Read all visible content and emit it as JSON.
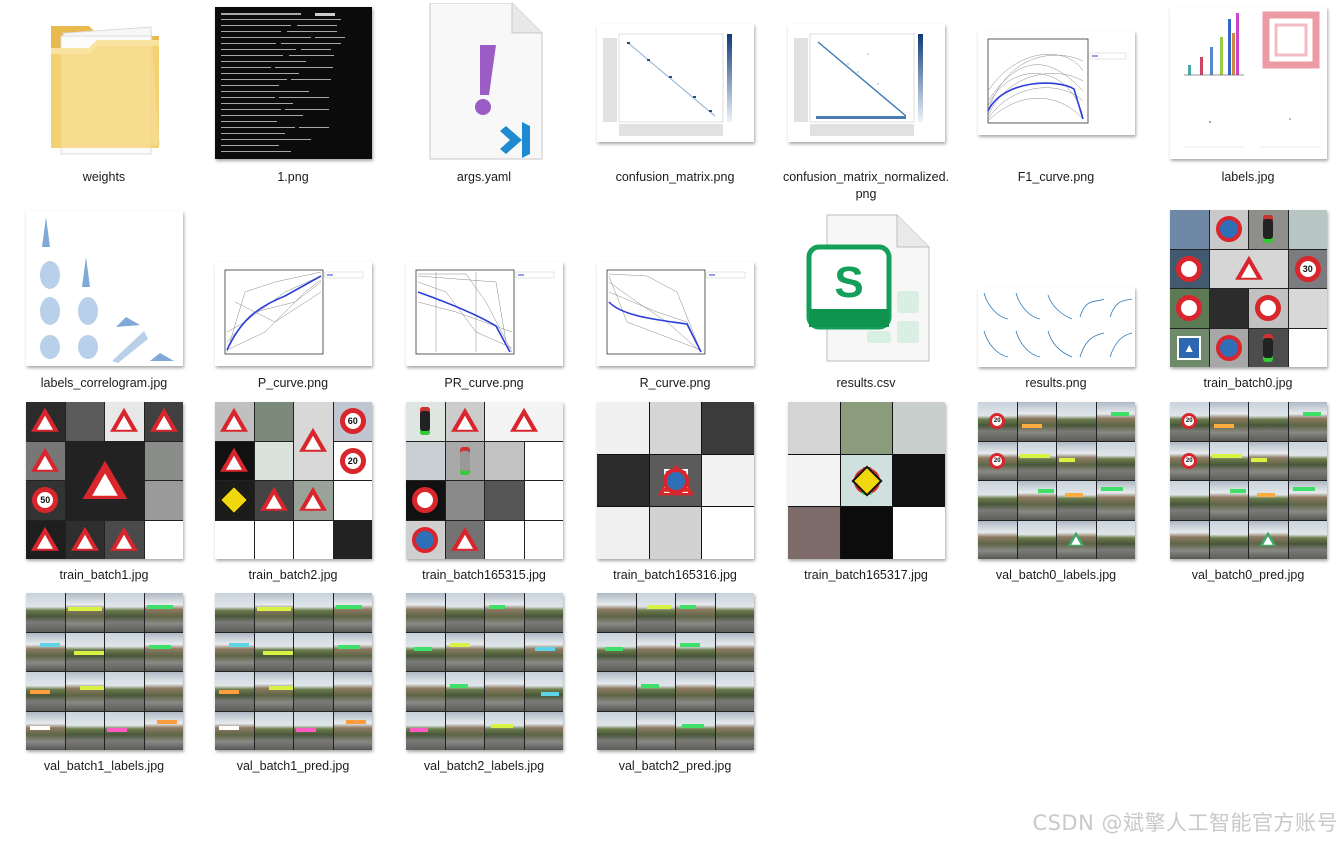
{
  "files": [
    {
      "name": "weights",
      "kind": "folder"
    },
    {
      "name": "1.png",
      "kind": "terminal"
    },
    {
      "name": "args.yaml",
      "kind": "yaml"
    },
    {
      "name": "confusion_matrix.png",
      "kind": "confusion"
    },
    {
      "name": "confusion_matrix_normalized.png",
      "kind": "confusion"
    },
    {
      "name": "F1_curve.png",
      "kind": "curve"
    },
    {
      "name": "labels.jpg",
      "kind": "labels"
    },
    {
      "name": "labels_correlogram.jpg",
      "kind": "correlogram"
    },
    {
      "name": "P_curve.png",
      "kind": "curve"
    },
    {
      "name": "PR_curve.png",
      "kind": "curve"
    },
    {
      "name": "R_curve.png",
      "kind": "curve"
    },
    {
      "name": "results.csv",
      "kind": "csv"
    },
    {
      "name": "results.png",
      "kind": "results"
    },
    {
      "name": "train_batch0.jpg",
      "kind": "train"
    },
    {
      "name": "train_batch1.jpg",
      "kind": "train"
    },
    {
      "name": "train_batch2.jpg",
      "kind": "train"
    },
    {
      "name": "train_batch165315.jpg",
      "kind": "train"
    },
    {
      "name": "train_batch165316.jpg",
      "kind": "train"
    },
    {
      "name": "train_batch165317.jpg",
      "kind": "train"
    },
    {
      "name": "val_batch0_labels.jpg",
      "kind": "val"
    },
    {
      "name": "val_batch0_pred.jpg",
      "kind": "val"
    },
    {
      "name": "val_batch1_labels.jpg",
      "kind": "val"
    },
    {
      "name": "val_batch1_pred.jpg",
      "kind": "val"
    },
    {
      "name": "val_batch2_labels.jpg",
      "kind": "val"
    },
    {
      "name": "val_batch2_pred.jpg",
      "kind": "val"
    }
  ],
  "csv_icon_letter": "S",
  "watermark": "CSDN @斌擎人工智能官方账号",
  "colors": {
    "folder": "#f3cf6e",
    "csv_green": "#14a05a",
    "vscode_blue": "#1f8ad2",
    "yaml_purple": "#9b5cc6",
    "sign_red": "#d8262c",
    "curve_blue": "#2a3fd8"
  }
}
